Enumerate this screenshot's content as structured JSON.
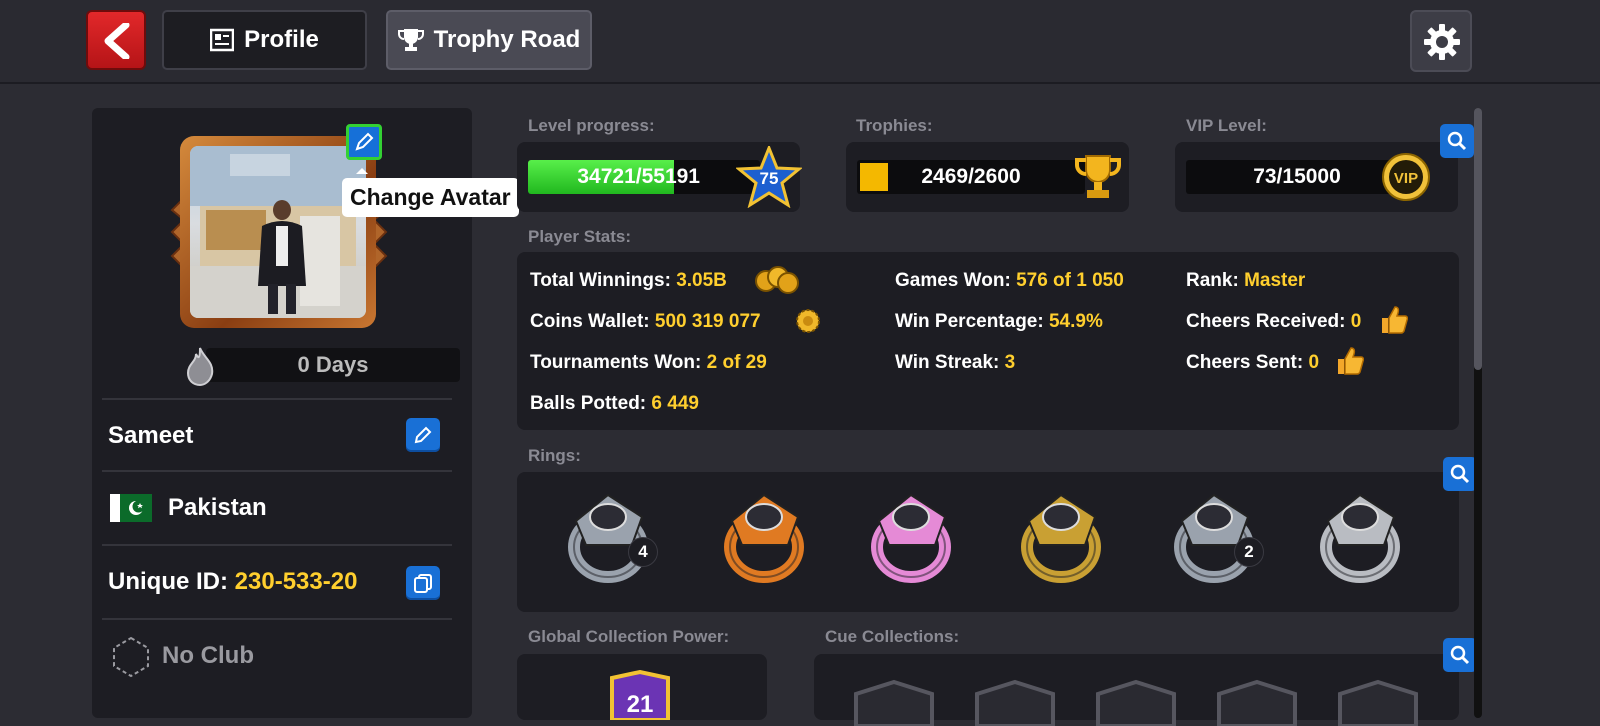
{
  "topbar": {
    "tabs": [
      {
        "label": "Profile",
        "icon": "id-card-icon"
      },
      {
        "label": "Trophy Road",
        "icon": "trophy-icon"
      }
    ]
  },
  "profile": {
    "tooltip": "Change Avatar",
    "streak_label": "0 Days",
    "name": "Sameet",
    "country": "Pakistan",
    "unique_id_label": "Unique ID:",
    "unique_id": "230-533-20",
    "club": "No Club"
  },
  "level": {
    "label": "Level progress:",
    "progress_text": "34721/55191",
    "current": 34721,
    "target": 55191,
    "level_number": "75"
  },
  "trophies": {
    "label": "Trophies:",
    "value_text": "2469/2600",
    "current": 2469,
    "target": 2600
  },
  "vip": {
    "label": "VIP Level:",
    "value_text": "73/15000",
    "badge": "VIP"
  },
  "stats": {
    "label": "Player Stats:",
    "items": [
      {
        "label": "Total Winnings:",
        "value": "3.05B"
      },
      {
        "label": "Coins Wallet:",
        "value": "500 319 077"
      },
      {
        "label": "Tournaments Won:",
        "value": "2 of 29"
      },
      {
        "label": "Balls Potted:",
        "value": "6 449"
      },
      {
        "label": "Games Won:",
        "value": "576 of 1 050"
      },
      {
        "label": "Win Percentage:",
        "value": "54.9%"
      },
      {
        "label": "Win Streak:",
        "value": "3"
      },
      {
        "label": "Rank:",
        "value": "Master"
      },
      {
        "label": "Cheers Received:",
        "value": "0"
      },
      {
        "label": "Cheers Sent:",
        "value": "0"
      }
    ]
  },
  "rings": {
    "label": "Rings:",
    "items": [
      {
        "name": "master-moscow-ring",
        "count": "4",
        "color": "#9aa2ad"
      },
      {
        "name": "legend-orange-ring",
        "count": "",
        "color": "#e07a22"
      },
      {
        "name": "legend-pink-ring",
        "count": "",
        "color": "#e58ad6"
      },
      {
        "name": "legend-gold-ring",
        "count": "",
        "color": "#c9a033"
      },
      {
        "name": "master-green-ring",
        "count": "2",
        "color": "#9aa2ad"
      },
      {
        "name": "uk-silver-ring",
        "count": "",
        "color": "#b9bcc2"
      }
    ]
  },
  "collection": {
    "global_label": "Global Collection Power:",
    "power": "21",
    "cue_label": "Cue Collections:"
  },
  "colors": {
    "accent_yellow": "#ffcf2e",
    "button_blue": "#1970d6",
    "progress_green": "#2fcf2f"
  }
}
